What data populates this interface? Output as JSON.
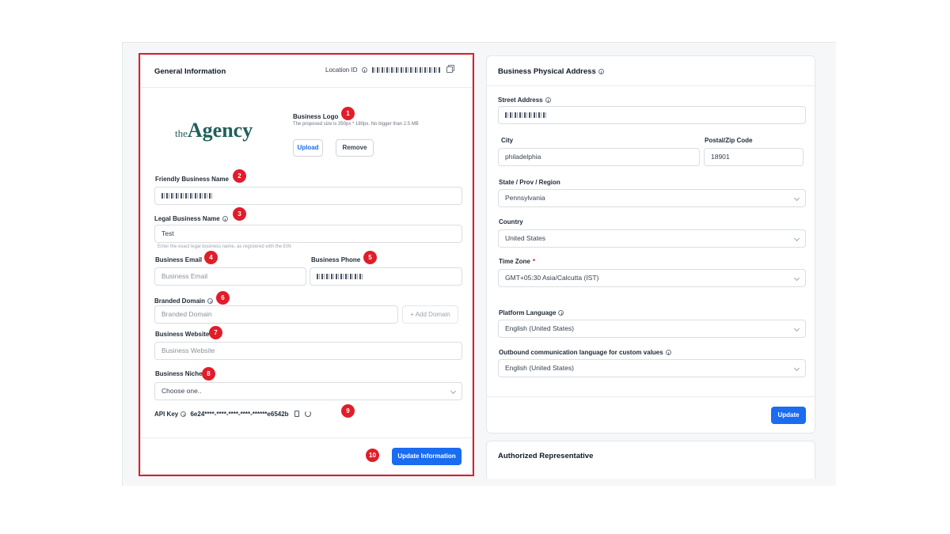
{
  "general": {
    "title": "General Information",
    "location_id_label": "Location ID",
    "logo_text_small": "the",
    "logo_text_big": "Agency",
    "business_logo_label": "Business Logo",
    "business_logo_hint": "The proposed size is 350px * 180px. No bigger than 2.5 MB",
    "upload_label": "Upload",
    "remove_label": "Remove",
    "friendly_name_label": "Friendly Business Name",
    "legal_name_label": "Legal Business Name",
    "legal_name_value": "Test",
    "legal_name_hint": "Enter the exact legal business name, as registered with the EIN",
    "email_label": "Business Email",
    "email_placeholder": "Business Email",
    "phone_label": "Business Phone",
    "branded_domain_label": "Branded Domain",
    "branded_domain_placeholder": "Branded Domain",
    "add_domain_label": "+ Add Domain",
    "website_label": "Business Website",
    "website_placeholder": "Business Website",
    "niche_label": "Business Niche",
    "niche_value": "Choose one..",
    "api_key_label": "API Key",
    "api_key_value": "6e24****-****-****-****-******e6542b",
    "update_label": "Update Information"
  },
  "badges": [
    "1",
    "2",
    "3",
    "4",
    "5",
    "6",
    "7",
    "8",
    "9",
    "10"
  ],
  "physical": {
    "title": "Business Physical Address",
    "street_label": "Street Address",
    "city_label": "City",
    "city_value": "philadelphia",
    "zip_label": "Postal/Zip Code",
    "zip_value": "18901",
    "state_label": "State / Prov / Region",
    "state_value": "Pennsylvania",
    "country_label": "Country",
    "country_value": "United States",
    "timezone_label": "Time Zone",
    "timezone_required": "*",
    "timezone_value": "GMT+05:30 Asia/Calcutta (IST)",
    "platform_lang_label": "Platform Language",
    "platform_lang_value": "English (United States)",
    "outbound_lang_label": "Outbound communication language for custom values",
    "outbound_lang_value": "English (United States)",
    "update_label": "Update"
  },
  "authrep": {
    "title": "Authorized Representative"
  },
  "colors": {
    "accent": "#1a6cf0",
    "highlight": "#e11d2a",
    "logo": "#1f5f5b"
  }
}
